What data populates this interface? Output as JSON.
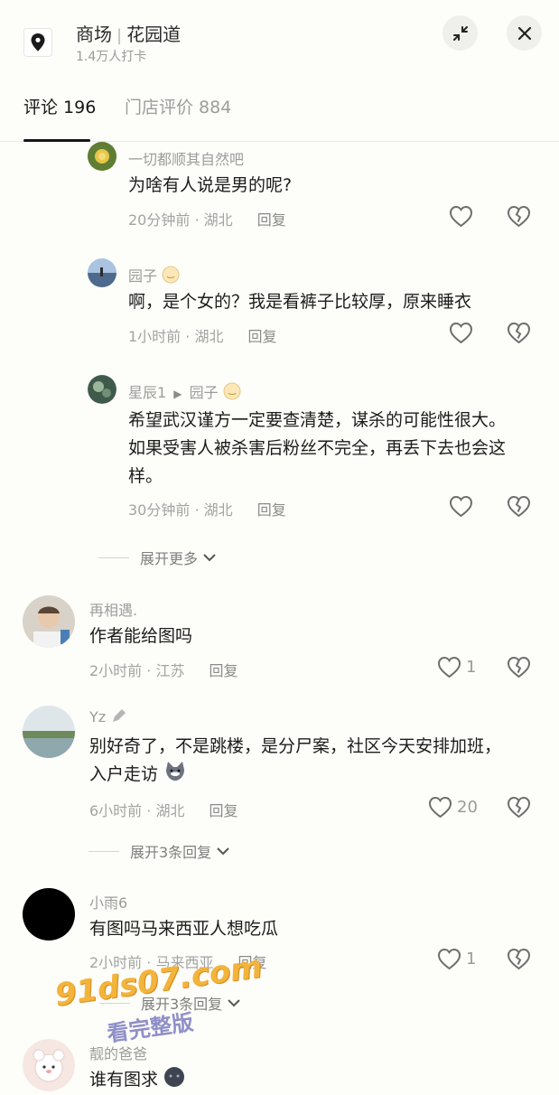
{
  "header": {
    "location_name": "商场",
    "location_place": "花园道",
    "checkins": "1.4万人打卡",
    "icons": {
      "pin": "location-pin-icon",
      "minimize": "minimize-icon",
      "close": "close-icon"
    }
  },
  "tabs": [
    {
      "label": "评论 196",
      "active": true
    },
    {
      "label": "门店评价 884",
      "active": false
    }
  ],
  "comments": [
    {
      "user": "一切都顺其自然吧",
      "text": "为啥有人说是男的呢?",
      "time": "20分钟前 · 湖北",
      "reply": "回复",
      "likes": ""
    },
    {
      "user": "园子",
      "text": "啊，是个女的？我是看裤子比较厚，原来睡衣",
      "time": "1小时前 · 湖北",
      "reply": "回复",
      "likes": ""
    },
    {
      "user": "星辰1",
      "reply_to": "园子",
      "text_lines": [
        "希望武汉谨方一定要查清楚，谋杀的可能性很大。",
        "如果受害人被杀害后粉丝不完全，再丢下去也会这",
        "样。"
      ],
      "time": "30分钟前 · 湖北",
      "reply": "回复",
      "likes": ""
    },
    {
      "user": "再相遇.",
      "text": "作者能给图吗",
      "time": "2小时前 · 江苏",
      "reply": "回复",
      "likes": "1"
    },
    {
      "user": "Yz",
      "text_lines": [
        "别好奇了，不是跳楼，是分尸案，社区今天安排加班，",
        "入户走访"
      ],
      "time": "6小时前 · 湖北",
      "reply": "回复",
      "likes": "20"
    },
    {
      "user": "小雨6",
      "text": "有图吗马来西亚人想吃瓜",
      "time": "2小时前 · 马来西亚",
      "reply": "回复",
      "likes": "1"
    },
    {
      "user": "靓的爸爸",
      "text": "谁有图求",
      "time": "",
      "reply": "",
      "likes": ""
    }
  ],
  "expand": {
    "more": "展开更多",
    "yz_replies": "展开3条回复",
    "xiaoyu_replies": "展开3条回复"
  },
  "watermark": {
    "site": "91ds07.com",
    "caption": "看完整版"
  },
  "colors": {
    "background": "#fdfdf9",
    "text": "#1c1c1c",
    "muted": "#a3a3a3",
    "watermark": "#f2b43c"
  }
}
